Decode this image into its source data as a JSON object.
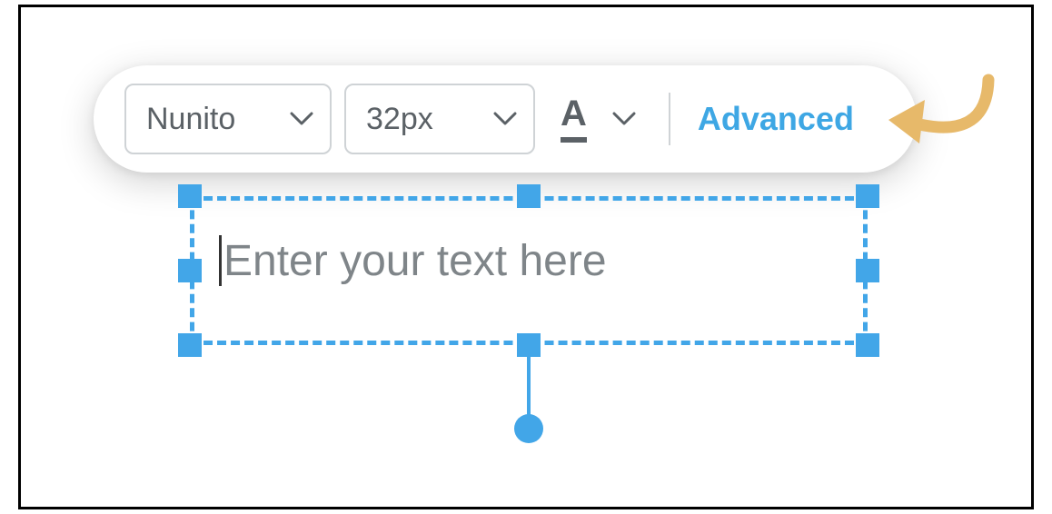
{
  "toolbar": {
    "font": {
      "value": "Nunito"
    },
    "size": {
      "value": "32px"
    },
    "color": {
      "glyph": "A"
    },
    "advanced_label": "Advanced"
  },
  "textbox": {
    "placeholder": "Enter your text here"
  },
  "colors": {
    "selection": "#42a6e8",
    "accent_link": "#3ea7e4",
    "annotation_arrow": "#e7b96a"
  }
}
